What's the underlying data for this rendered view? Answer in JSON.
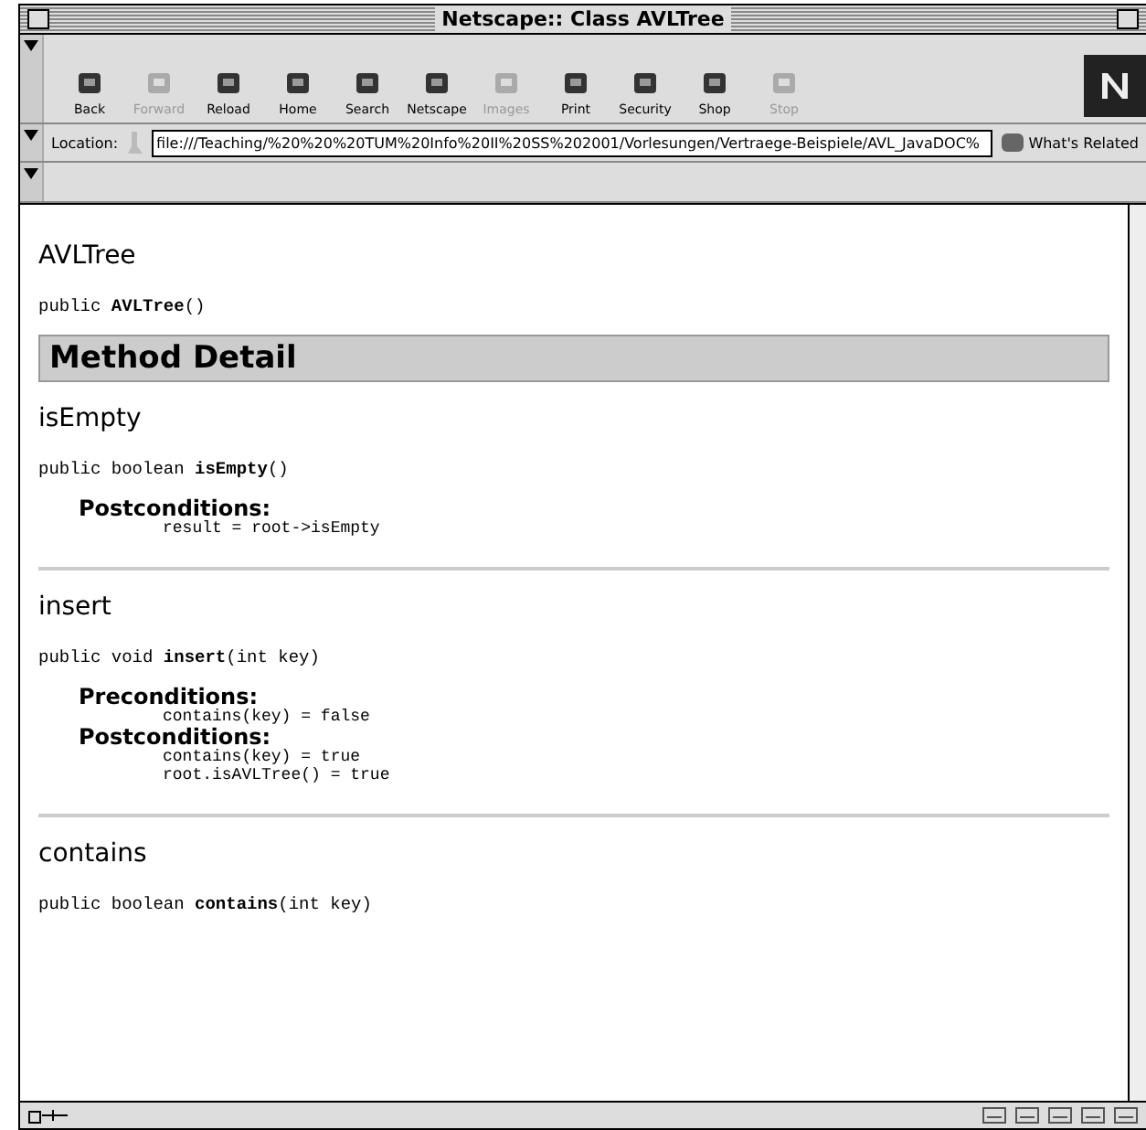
{
  "window": {
    "title": "Netscape:: Class AVLTree"
  },
  "toolbar": [
    {
      "label": "Back",
      "disabled": false
    },
    {
      "label": "Forward",
      "disabled": true
    },
    {
      "label": "Reload",
      "disabled": false
    },
    {
      "label": "Home",
      "disabled": false
    },
    {
      "label": "Search",
      "disabled": false
    },
    {
      "label": "Netscape",
      "disabled": false
    },
    {
      "label": "Images",
      "disabled": true
    },
    {
      "label": "Print",
      "disabled": false
    },
    {
      "label": "Security",
      "disabled": false
    },
    {
      "label": "Shop",
      "disabled": false
    },
    {
      "label": "Stop",
      "disabled": true
    }
  ],
  "location": {
    "label": "Location:",
    "value": "file:///Teaching/%20%20%20TUM%20Info%20II%20SS%202001/Vorlesungen/Vertraege-Beispiele/AVL_JavaDOC%",
    "related": "What's Related"
  },
  "content": [
    {
      "kind": "heading",
      "text": "AVLTree"
    },
    {
      "kind": "signature",
      "text": "public **AVLTree**()"
    },
    {
      "kind": "banner",
      "text": "Method Detail"
    },
    {
      "kind": "heading",
      "text": "isEmpty"
    },
    {
      "kind": "signature",
      "text": "public boolean **isEmpty**()"
    },
    {
      "kind": "conditions",
      "sections": [
        {
          "label": "Postconditions:",
          "lines": [
            "result = root->isEmpty"
          ]
        }
      ]
    },
    {
      "kind": "rule"
    },
    {
      "kind": "heading",
      "text": "insert"
    },
    {
      "kind": "signature",
      "text": "public void **insert**(int key)"
    },
    {
      "kind": "conditions",
      "sections": [
        {
          "label": "Preconditions:",
          "lines": [
            "contains(key) = false"
          ]
        },
        {
          "label": "Postconditions:",
          "lines": [
            "contains(key) = true",
            "root.isAVLTree() = true"
          ]
        }
      ]
    },
    {
      "kind": "rule"
    },
    {
      "kind": "heading",
      "text": "contains"
    },
    {
      "kind": "signature",
      "text": "public boolean **contains**(int key)"
    }
  ]
}
